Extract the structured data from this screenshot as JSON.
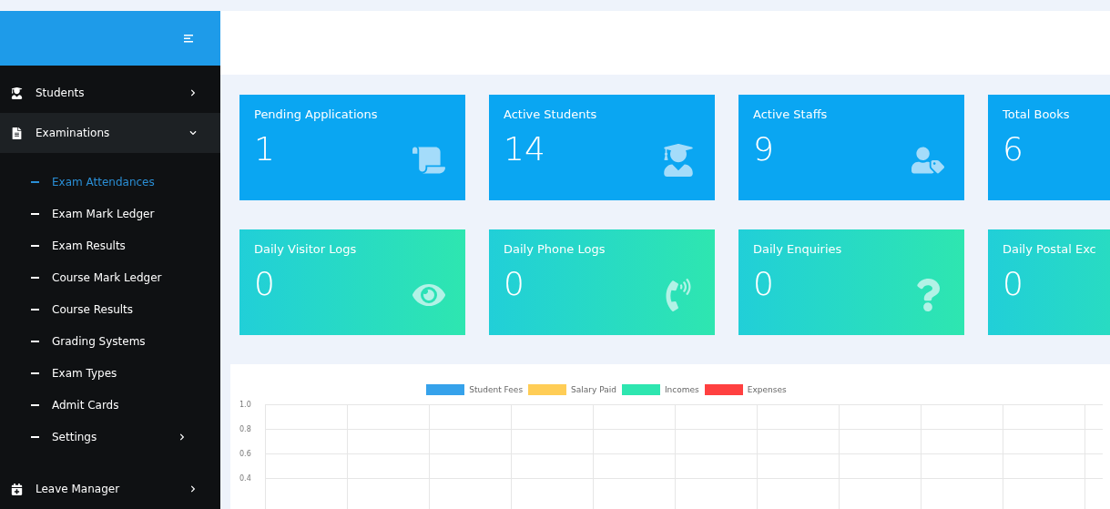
{
  "sidebar": {
    "items": [
      {
        "label": "Students",
        "expanded": false
      },
      {
        "label": "Examinations",
        "expanded": true,
        "children": [
          {
            "label": "Exam Attendances",
            "selected": true,
            "kind": "link"
          },
          {
            "label": "Exam Mark Ledger",
            "selected": false,
            "kind": "link"
          },
          {
            "label": "Exam Results",
            "selected": false,
            "kind": "link"
          },
          {
            "label": "Course Mark Ledger",
            "selected": false,
            "kind": "link"
          },
          {
            "label": "Course Results",
            "selected": false,
            "kind": "link"
          },
          {
            "label": "Grading Systems",
            "selected": false,
            "kind": "link"
          },
          {
            "label": "Exam Types",
            "selected": false,
            "kind": "link"
          },
          {
            "label": "Admit Cards",
            "selected": false,
            "kind": "link"
          },
          {
            "label": "Settings",
            "selected": false,
            "kind": "submenu"
          }
        ]
      },
      {
        "label": "Leave Manager",
        "expanded": false
      }
    ]
  },
  "cards": [
    {
      "title": "Pending Applications",
      "value": "1",
      "kind": "info"
    },
    {
      "title": "Active Students",
      "value": "14",
      "kind": "info"
    },
    {
      "title": "Active Staffs",
      "value": "9",
      "kind": "info"
    },
    {
      "title": "Total Books",
      "value": "6",
      "kind": "info"
    },
    {
      "title": "Daily Visitor Logs",
      "value": "0",
      "kind": "success"
    },
    {
      "title": "Daily Phone Logs",
      "value": "0",
      "kind": "success"
    },
    {
      "title": "Daily Enquiries",
      "value": "0",
      "kind": "success"
    },
    {
      "title": "Daily Postal Exc",
      "value": "0",
      "kind": "success"
    }
  ],
  "chart": {
    "chart_data": {
      "type": "bar",
      "grid": true,
      "ylim": [
        0,
        1
      ],
      "yticks": [
        {
          "value": 1,
          "label": "1.0"
        },
        {
          "value": 0.8,
          "label": "0.8"
        },
        {
          "value": 0.6,
          "label": "0.6"
        },
        {
          "value": 0.4,
          "label": "0.4"
        }
      ],
      "series": [
        {
          "name": "Student Fees",
          "color": "#36a2eb"
        },
        {
          "name": "Salary Paid",
          "color": "#ffcd56"
        },
        {
          "name": "Incomes",
          "color": "#2ee6b0"
        },
        {
          "name": "Expenses",
          "color": "#ff4040"
        }
      ]
    }
  }
}
